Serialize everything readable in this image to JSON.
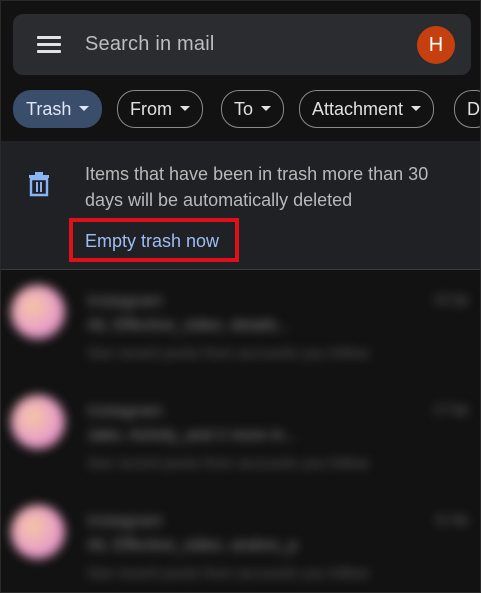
{
  "search": {
    "placeholder": "Search in mail",
    "avatar_initial": "H",
    "avatar_color": "#c6400f"
  },
  "filters": {
    "chips": [
      {
        "label": "Trash",
        "active": true
      },
      {
        "label": "From",
        "active": false
      },
      {
        "label": "To",
        "active": false
      },
      {
        "label": "Attachment",
        "active": false
      },
      {
        "label": "D",
        "active": false
      }
    ]
  },
  "banner": {
    "icon": "trash-icon",
    "message": "Items that have been in trash more than 30 days will be automatically deleted",
    "action_label": "Empty trash now",
    "action_color": "#9dbdf5",
    "highlight_color": "#e0101a"
  },
  "mail_list": {
    "rows": [
      {
        "sender": "Instagram",
        "time": "10:2p",
        "subject": "Ali, Effective_video, details...",
        "snippet": "See recent posts from accounts you follow"
      },
      {
        "sender": "Instagram",
        "time": "17:0p",
        "subject": "Jake, Ashely_and 2 more in...",
        "snippet": "See recent posts from accounts you follow"
      },
      {
        "sender": "Instagram",
        "time": "11:0p",
        "subject": "Ali, Effective_video, andres_p",
        "snippet": "See recent posts from accounts you follow"
      }
    ]
  }
}
